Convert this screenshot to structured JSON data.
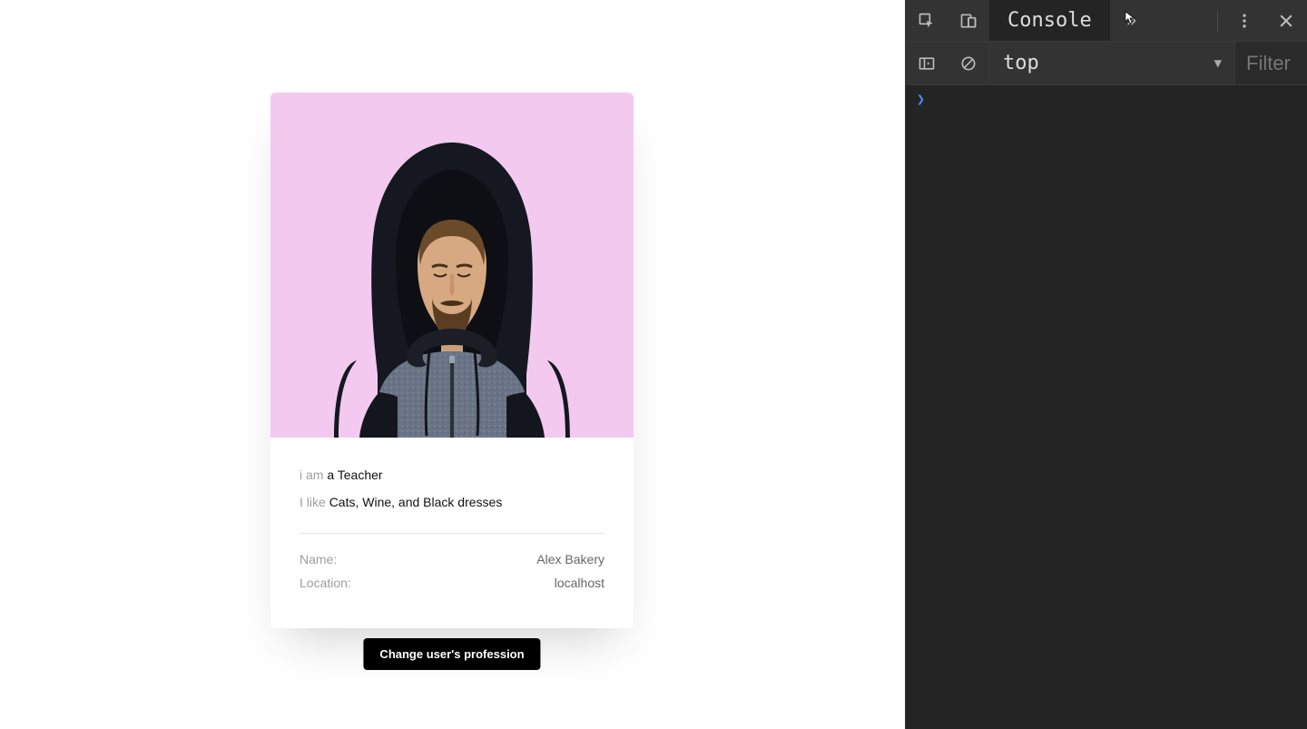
{
  "card": {
    "iam_prefix": "i am ",
    "iam_value": "a Teacher",
    "ilike_prefix": "I like ",
    "ilike_value": "Cats, Wine, and Black dresses",
    "rows": [
      {
        "label": "Name:",
        "value": "Alex Bakery"
      },
      {
        "label": "Location:",
        "value": "localhost"
      }
    ]
  },
  "button_label": "Change user's profession",
  "devtools": {
    "tabs": {
      "console": "Console"
    },
    "context": "top",
    "filter_placeholder": "Filter",
    "prompt_glyph": "❯"
  }
}
